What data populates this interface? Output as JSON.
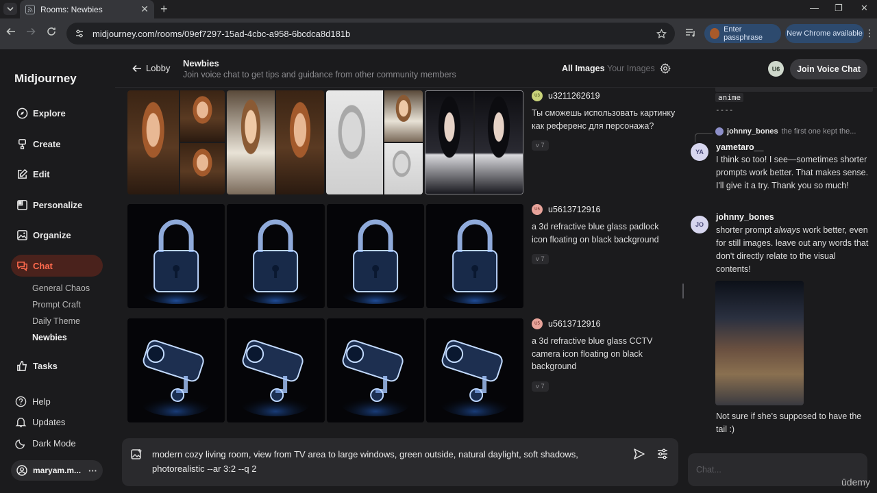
{
  "browser": {
    "tab_title": "Rooms: Newbies",
    "url": "midjourney.com/rooms/09ef7297-15ad-4cbc-a958-6bcdca8d181b",
    "passphrase_label": "Enter passphrase",
    "update_label": "New Chrome available"
  },
  "sidebar": {
    "brand": "Midjourney",
    "items": [
      {
        "label": "Explore",
        "icon": "compass-icon"
      },
      {
        "label": "Create",
        "icon": "brush-icon"
      },
      {
        "label": "Edit",
        "icon": "edit-icon"
      },
      {
        "label": "Personalize",
        "icon": "personalize-icon"
      },
      {
        "label": "Organize",
        "icon": "image-icon"
      },
      {
        "label": "Chat",
        "icon": "chat-icon"
      }
    ],
    "rooms": [
      "General Chaos",
      "Prompt Craft",
      "Daily Theme",
      "Newbies"
    ],
    "tasks": "Tasks",
    "help": "Help",
    "updates": "Updates",
    "dark_mode": "Dark Mode",
    "user": "maryam.m..."
  },
  "header": {
    "back_label": "Lobby",
    "room_name": "Newbies",
    "room_desc": "Join voice chat to get tips and guidance from other community members",
    "all_images": "All Images",
    "your_images": "Your Images",
    "user_initials": "U6",
    "join_voice": "Join Voice Chat"
  },
  "feed": [
    {
      "user": "u3211262619",
      "prompt": "Ты сможешь использовать картинку как референс для персонажа?",
      "version": "v 7",
      "avatar_color": "#c9d37a"
    },
    {
      "user": "u5613712916",
      "prompt": "a 3d refractive blue glass padlock icon floating on black background",
      "version": "v 7",
      "avatar_color": "#e7a39a"
    },
    {
      "user": "u5613712916",
      "prompt": "a 3d refractive blue glass CCTV camera icon floating on black background",
      "version": "v 7",
      "avatar_color": "#e7a39a"
    }
  ],
  "chat": {
    "code_tail": "anime",
    "code_sep": "----",
    "reply_to_user": "johnny_bones",
    "reply_preview": "the first one kept the...",
    "messages": [
      {
        "initials": "YA",
        "name": "yametaro__",
        "text": "I think so too! I see—sometimes shorter prompts work better. That makes sense. I'll give it a try. Thank you so much!"
      },
      {
        "initials": "JO",
        "name": "johnny_bones",
        "text_before": "shorter prompt ",
        "text_em": "always",
        "text_after": " work better, even for still images. leave out any words that don't directly relate to the visual contents!"
      }
    ],
    "last_message": "Not sure if she's supposed to have the tail :)",
    "input_placeholder": "Chat..."
  },
  "composer": {
    "prompt": "modern cozy living room, view from TV area to large windows, green outside, natural daylight, soft shadows, photorealistic --ar 3:2 --q 2"
  },
  "watermark": "ūdemy"
}
